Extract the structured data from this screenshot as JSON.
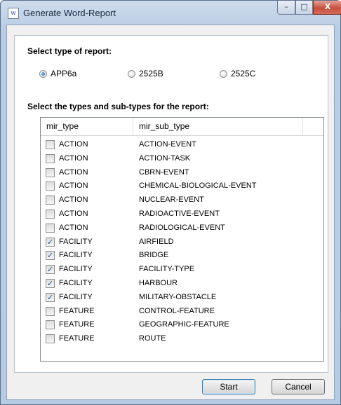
{
  "window": {
    "title": "Generate Word-Report",
    "icon": "word-report-icon",
    "minimize": "–",
    "maximize": "□",
    "close": "X"
  },
  "report_type": {
    "heading": "Select type of report:",
    "options": [
      {
        "label": "APP6a",
        "selected": true
      },
      {
        "label": "2525B",
        "selected": false
      },
      {
        "label": "2525C",
        "selected": false
      }
    ]
  },
  "types_section": {
    "heading": "Select the types and sub-types for the report:",
    "columns": [
      "mir_type",
      "mir_sub_type"
    ],
    "rows": [
      {
        "type": "ACTION",
        "sub_type": "ACTION-EVENT",
        "checked": false
      },
      {
        "type": "ACTION",
        "sub_type": "ACTION-TASK",
        "checked": false
      },
      {
        "type": "ACTION",
        "sub_type": "CBRN-EVENT",
        "checked": false
      },
      {
        "type": "ACTION",
        "sub_type": "CHEMICAL-BIOLOGICAL-EVENT",
        "checked": false
      },
      {
        "type": "ACTION",
        "sub_type": "NUCLEAR-EVENT",
        "checked": false
      },
      {
        "type": "ACTION",
        "sub_type": "RADIOACTIVE-EVENT",
        "checked": false
      },
      {
        "type": "ACTION",
        "sub_type": "RADIOLOGICAL-EVENT",
        "checked": false
      },
      {
        "type": "FACILITY",
        "sub_type": "AIRFIELD",
        "checked": true
      },
      {
        "type": "FACILITY",
        "sub_type": "BRIDGE",
        "checked": true
      },
      {
        "type": "FACILITY",
        "sub_type": "FACILITY-TYPE",
        "checked": true
      },
      {
        "type": "FACILITY",
        "sub_type": "HARBOUR",
        "checked": true
      },
      {
        "type": "FACILITY",
        "sub_type": "MILITARY-OBSTACLE",
        "checked": true
      },
      {
        "type": "FEATURE",
        "sub_type": "CONTROL-FEATURE",
        "checked": false
      },
      {
        "type": "FEATURE",
        "sub_type": "GEOGRAPHIC-FEATURE",
        "checked": false
      },
      {
        "type": "FEATURE",
        "sub_type": "ROUTE",
        "checked": false
      }
    ]
  },
  "buttons": {
    "start": "Start",
    "cancel": "Cancel"
  },
  "colors": {
    "titlebar": "#b9cde4",
    "close_button": "#c6503f",
    "check_mark": "#2b4f8a"
  }
}
